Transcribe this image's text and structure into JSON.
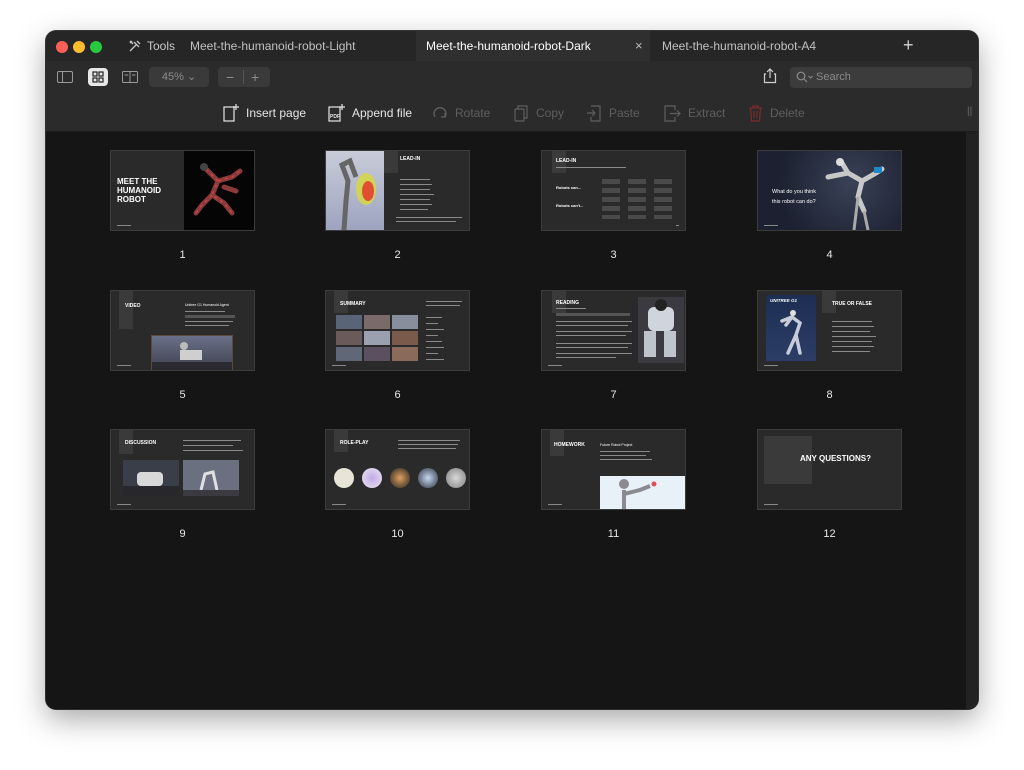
{
  "tabs": {
    "tools_label": "Tools",
    "items": [
      {
        "label": "Meet-the-humanoid-robot-Light"
      },
      {
        "label": "Meet-the-humanoid-robot-Dark"
      },
      {
        "label": "Meet-the-humanoid-robot-A4"
      }
    ],
    "close_glyph": "×",
    "add_glyph": "+"
  },
  "toolbar": {
    "zoom_value": "45%",
    "zoom_chevron": "⌄",
    "zoom_out": "−",
    "zoom_in": "+",
    "search_placeholder": "Search"
  },
  "actions": {
    "insert_page": "Insert page",
    "append_file": "Append file",
    "rotate": "Rotate",
    "copy": "Copy",
    "paste": "Paste",
    "extract": "Extract",
    "delete": "Delete"
  },
  "pages": [
    {
      "number": "1",
      "title": "MEET THE\nHUMANOID\nROBOT"
    },
    {
      "number": "2",
      "title": "LEAD-IN"
    },
    {
      "number": "3",
      "title": "LEAD-IN",
      "rows": [
        "Robots can...",
        "Robots can't..."
      ]
    },
    {
      "number": "4",
      "title": "What do you think\nthis robot can do?"
    },
    {
      "number": "5",
      "title": "VIDEO",
      "subtitle": "Unitree G1 Humanoid Agent"
    },
    {
      "number": "6",
      "title": "SUMMARY"
    },
    {
      "number": "7",
      "title": "READING"
    },
    {
      "number": "8",
      "title": "TRUE OR FALSE",
      "brand": "UNITREE G1"
    },
    {
      "number": "9",
      "title": "DISCUSSION"
    },
    {
      "number": "10",
      "title": "ROLE-PLAY"
    },
    {
      "number": "11",
      "title": "HOMEWORK",
      "subtitle": "Future Robot Project"
    },
    {
      "number": "12",
      "title": "ANY QUESTIONS?"
    }
  ],
  "colors": {
    "window_bg": "#161616",
    "toolbar_bg": "#2b2b2b",
    "tab_active_bg": "#2f2f2f",
    "delete_icon": "#7a2a2a"
  }
}
